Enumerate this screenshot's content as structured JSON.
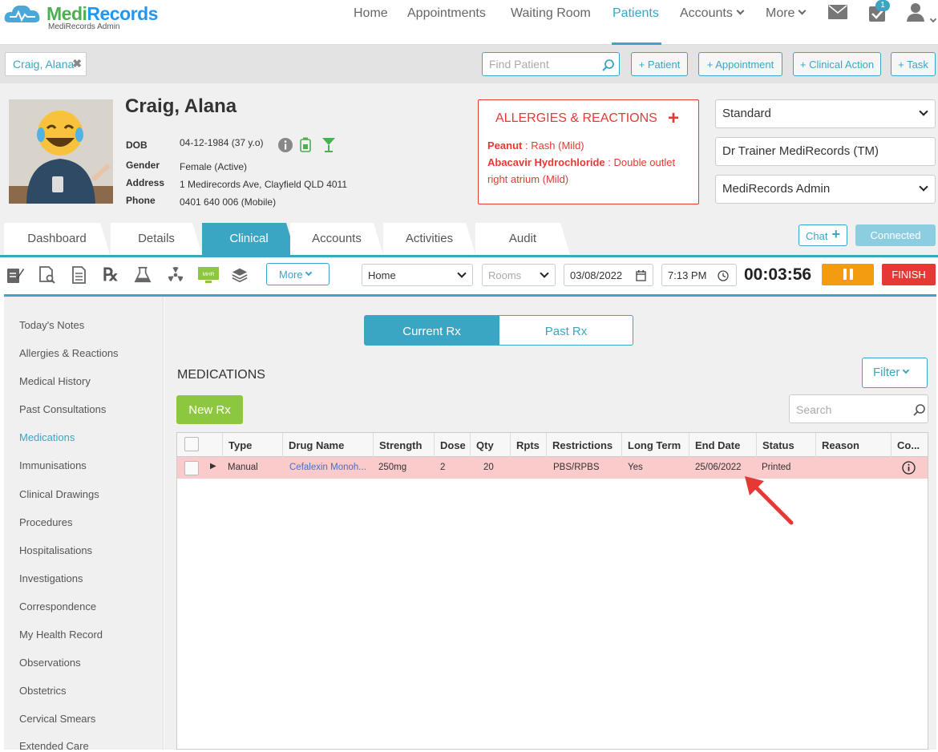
{
  "brand": {
    "name_part1": "Medi",
    "name_part2": "Records",
    "subtitle": "MediRecords Admin"
  },
  "nav": {
    "items": [
      {
        "label": "Home"
      },
      {
        "label": "Appointments"
      },
      {
        "label": "Waiting Room"
      },
      {
        "label": "Patients",
        "active": true
      },
      {
        "label": "Accounts",
        "dropdown": true
      },
      {
        "label": "More",
        "dropdown": true
      }
    ],
    "task_badge": "1"
  },
  "subbar": {
    "open_patient_tab": "Craig, Alana",
    "close_symbol": "✖",
    "find_placeholder": "Find Patient",
    "buttons": [
      "+ Patient",
      "+ Appointment",
      "+ Clinical Action",
      "+ Task"
    ]
  },
  "patient": {
    "name": "Craig, Alana",
    "fields": [
      {
        "label": "DOB",
        "value": "04-12-1984 (37 y.o)"
      },
      {
        "label": "Gender",
        "value": "Female (Active)"
      },
      {
        "label": "Address",
        "value": "1 Medirecords Ave, Clayfield QLD 4011"
      },
      {
        "label": "Phone",
        "value": "0401 640 006 (Mobile)"
      }
    ]
  },
  "allergies": {
    "title": "ALLERGIES & REACTIONS",
    "add_symbol": "+",
    "items": [
      {
        "substance": "Peanut",
        "reaction": "Rash (Mild)"
      },
      {
        "substance": "Abacavir Hydrochloride",
        "reaction": "Double outlet right atrium (Mild)"
      }
    ]
  },
  "right_panel": {
    "consult_type": "Standard",
    "practitioner": "Dr Trainer MediRecords (TM)",
    "practice": "MediRecords Admin"
  },
  "tabs": {
    "items": [
      "Dashboard",
      "Details",
      "Clinical",
      "Accounts",
      "Activities",
      "Audit"
    ],
    "active": "Clinical",
    "chat_label": "Chat",
    "connected_label": "Connected"
  },
  "toolbar": {
    "more_label": "More",
    "location": "Home",
    "rooms_placeholder": "Rooms",
    "date": "03/08/2022",
    "time": "7:13 PM",
    "timer": "00:03:56",
    "finish_label": "FINISH",
    "mhr_icon_text": "MHR"
  },
  "sidebar": {
    "items": [
      "Today's Notes",
      "Allergies & Reactions",
      "Medical History",
      "Past Consultations",
      "Medications",
      "Immunisations",
      "Clinical Drawings",
      "Procedures",
      "Hospitalisations",
      "Investigations",
      "Correspondence",
      "My Health Record",
      "Observations",
      "Obstetrics",
      "Cervical Smears",
      "Extended Care"
    ],
    "active": "Medications"
  },
  "medications": {
    "tabs": [
      "Current Rx",
      "Past Rx"
    ],
    "active_tab": "Current Rx",
    "title": "MEDICATIONS",
    "filter_label": "Filter",
    "new_rx_label": "New Rx",
    "search_placeholder": "Search",
    "columns": [
      "Type",
      "Drug Name",
      "Strength",
      "Dose",
      "Qty",
      "Rpts",
      "Restrictions",
      "Long Term",
      "End Date",
      "Status",
      "Reason",
      "Co..."
    ],
    "rows": [
      {
        "type": "Manual",
        "drug": "Cefalexin Monoh...",
        "strength": "250mg",
        "dose": "2",
        "qty": "20",
        "rpts": "",
        "restrictions": "PBS/RPBS",
        "long_term": "Yes",
        "end_date": "25/06/2022",
        "status": "Printed",
        "reason": "",
        "comment_icon": "info-icon"
      }
    ]
  },
  "colors": {
    "accent": "#3aa6c4",
    "danger": "#e53935",
    "success": "#8dc63f",
    "warning": "#f39c12",
    "highlight_row": "#fbcaca"
  }
}
